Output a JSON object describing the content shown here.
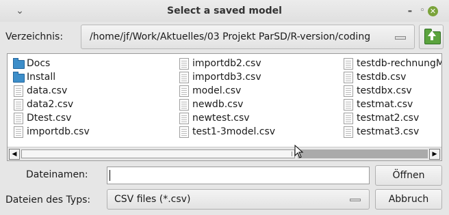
{
  "window": {
    "title": "Select a saved model",
    "menu_glyph": "⌄",
    "minimize_glyph": "-",
    "maximize_glyph": "◦",
    "close_glyph": "✕"
  },
  "directory": {
    "label": "Verzeichnis:",
    "path": "/home/jf/Work/Aktuelles/03 Projekt ParSD/R-version/coding"
  },
  "files": {
    "columns": [
      [
        {
          "name": "Docs",
          "type": "folder"
        },
        {
          "name": "Install",
          "type": "folder"
        },
        {
          "name": "data.csv",
          "type": "file"
        },
        {
          "name": "data2.csv",
          "type": "file"
        },
        {
          "name": "Dtest.csv",
          "type": "file"
        },
        {
          "name": "importdb.csv",
          "type": "file"
        }
      ],
      [
        {
          "name": "importdb2.csv",
          "type": "file"
        },
        {
          "name": "importdb3.csv",
          "type": "file"
        },
        {
          "name": "model.csv",
          "type": "file"
        },
        {
          "name": "newdb.csv",
          "type": "file"
        },
        {
          "name": "newtest.csv",
          "type": "file"
        },
        {
          "name": "test1-3model.csv",
          "type": "file"
        }
      ],
      [
        {
          "name": "testdb-rechnungM",
          "type": "file"
        },
        {
          "name": "testdb.csv",
          "type": "file"
        },
        {
          "name": "testdbx.csv",
          "type": "file"
        },
        {
          "name": "testmat.csv",
          "type": "file"
        },
        {
          "name": "testmat2.csv",
          "type": "file"
        },
        {
          "name": "testmat3.csv",
          "type": "file"
        }
      ]
    ],
    "scroll_left_glyph": "◀",
    "scroll_right_glyph": "▶"
  },
  "filename": {
    "label": "Dateinamen:",
    "value": ""
  },
  "filetype": {
    "label": "Dateien des Typs:",
    "selected": "CSV files (*.csv)"
  },
  "buttons": {
    "open": "Öffnen",
    "cancel": "Abbruch"
  },
  "colors": {
    "folder_icon": "#3d8ec9",
    "close_button": "#7aa33a",
    "up_folder_icon": "#5ba33e"
  }
}
